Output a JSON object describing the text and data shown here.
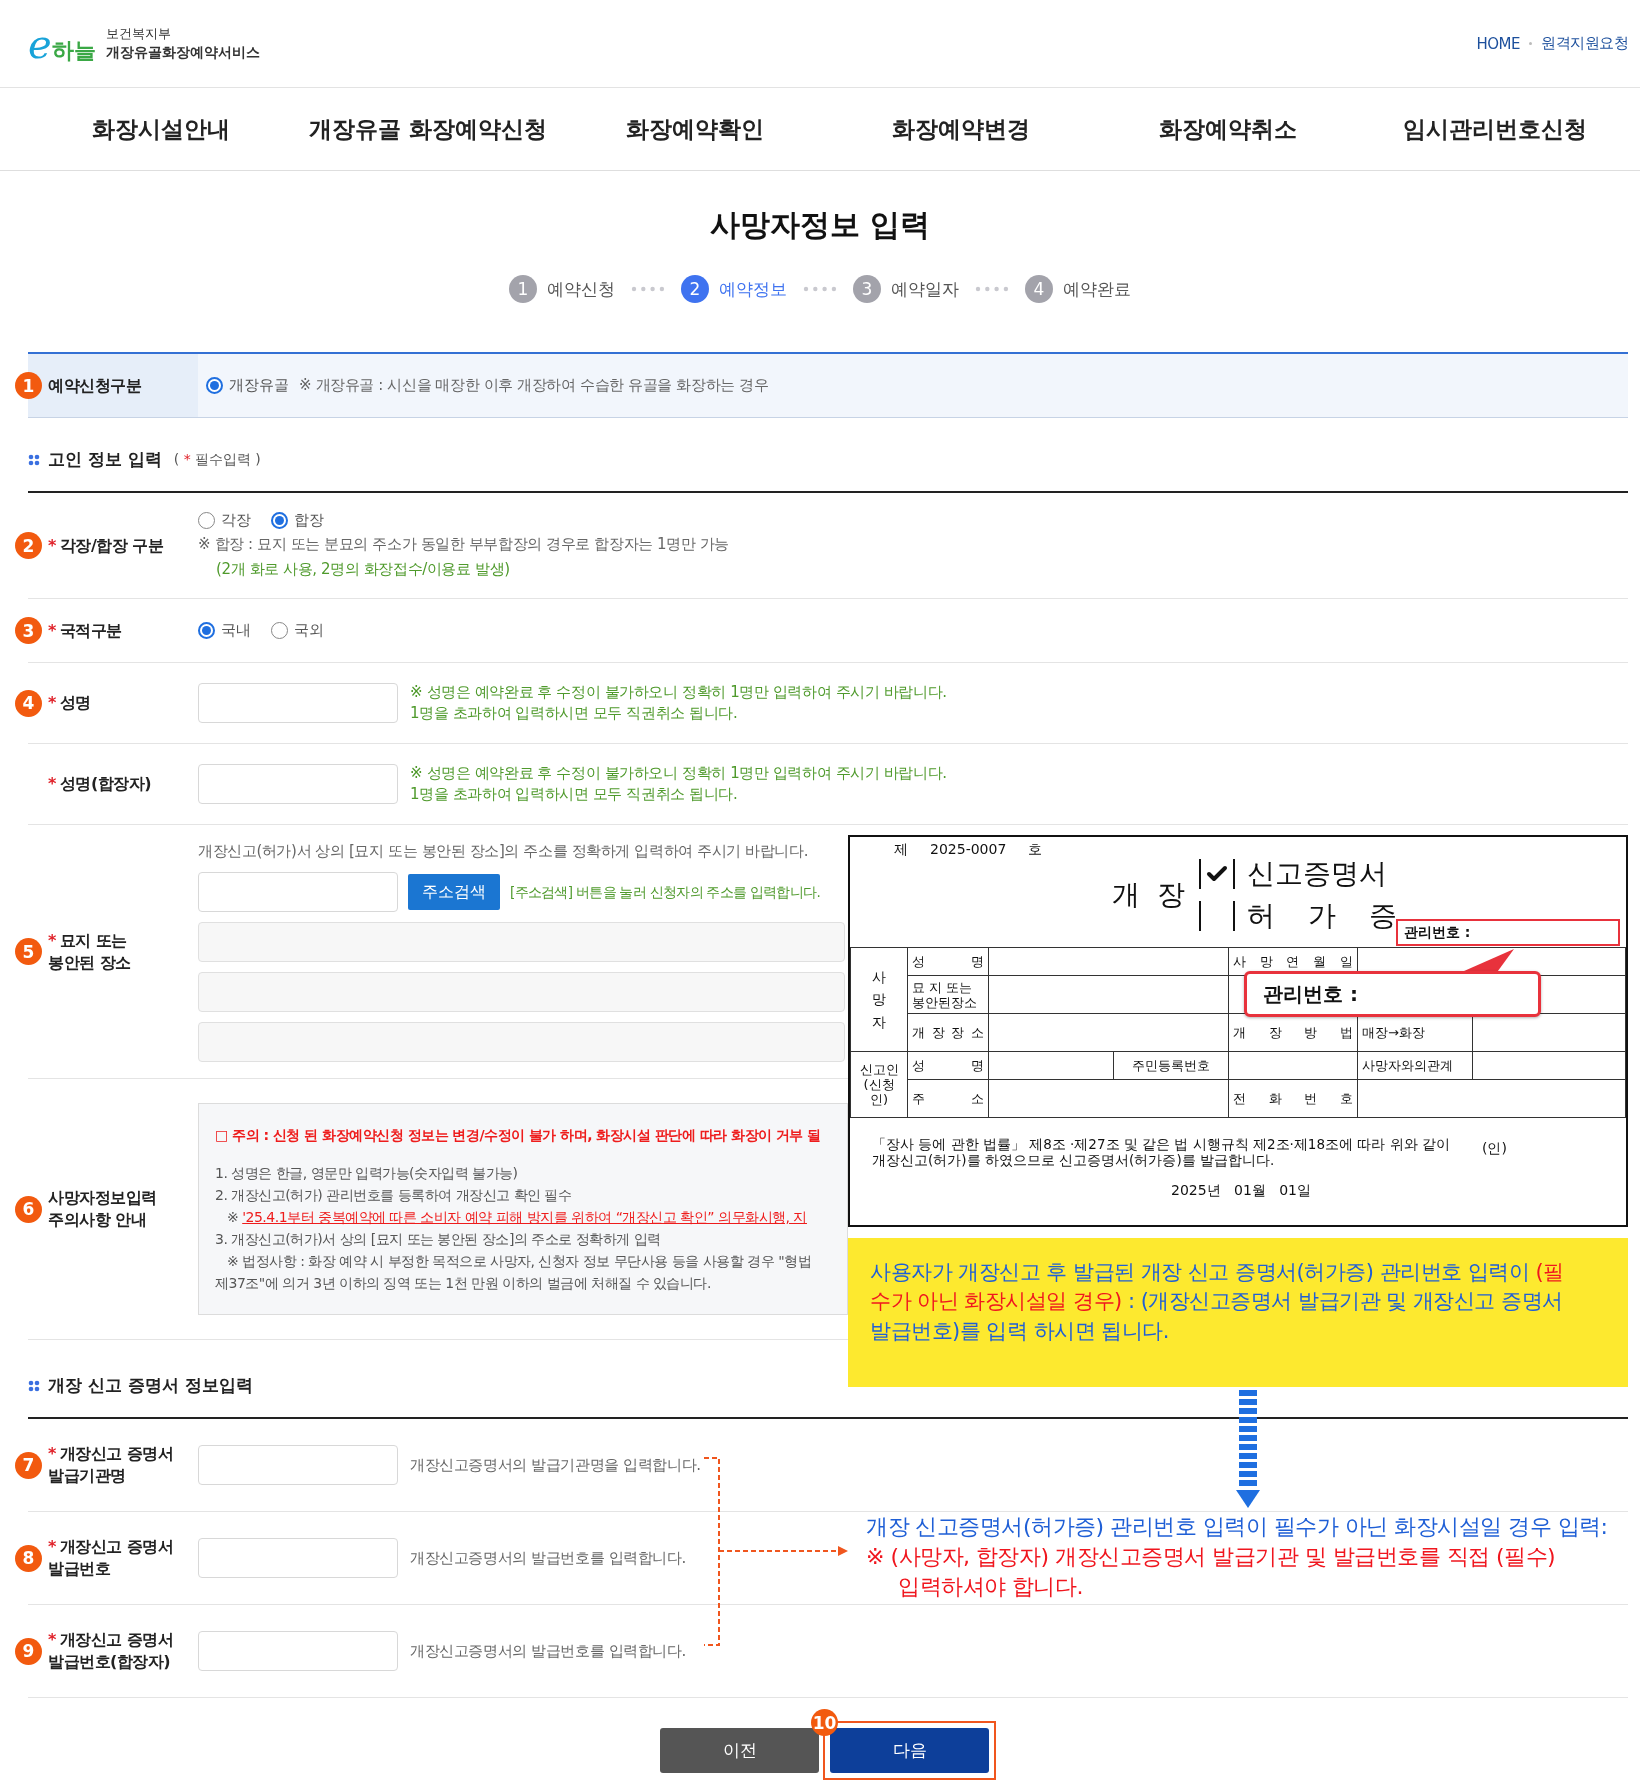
{
  "header": {
    "logo": {
      "mark": "e",
      "word": "하늘"
    },
    "ministry": "보건복지부",
    "service": "개장유골화장예약서비스",
    "links": [
      "HOME",
      "원격지원요청"
    ]
  },
  "nav": [
    "화장시설안내",
    "개장유골 화장예약신청",
    "화장예약확인",
    "화장예약변경",
    "화장예약취소",
    "임시관리번호신청"
  ],
  "page_title": "사망자정보 입력",
  "steps": [
    {
      "number": "1",
      "label": "예약신청",
      "selected": false
    },
    {
      "number": "2",
      "label": "예약정보",
      "selected": true
    },
    {
      "number": "3",
      "label": "예약일자",
      "selected": false
    },
    {
      "number": "4",
      "label": "예약완료",
      "selected": false
    }
  ],
  "reservation_type": {
    "badge": "1",
    "label": "예약신청구분",
    "options": [
      {
        "label": "개장유골",
        "selected": true
      }
    ],
    "note": "※ 개장유골 : 시신을 매장한 이후 개장하여 수습한 유골을 화장하는 경우"
  },
  "deceased_section": {
    "title": "고인 정보 입력",
    "required_hint": {
      "open": "(",
      "mark": "*",
      "text": "필수입력",
      "close": ")"
    },
    "rows": [
      {
        "kind": "radio",
        "badge": "2",
        "required_mark": "*",
        "label_lines": [
          "각장/합장 구분"
        ],
        "options": [
          {
            "label": "각장",
            "selected": false
          },
          {
            "label": "합장",
            "selected": true
          }
        ],
        "note": "※ 합장 : 묘지 또는 분묘의 주소가 동일한 부부합장의 경우로 합장자는 1명만 가능",
        "sub_note": "(2개 화로 사용, 2명의 화장접수/이용료 발생)"
      },
      {
        "kind": "radio",
        "badge": "3",
        "required_mark": "*",
        "label_lines": [
          "국적구분"
        ],
        "options": [
          {
            "label": "국내",
            "selected": true
          },
          {
            "label": "국외",
            "selected": false
          }
        ]
      },
      {
        "kind": "input",
        "badge": "4",
        "required_mark": "*",
        "label_lines": [
          "성명"
        ],
        "hints": [
          "※ 성명은 예약완료 후 수정이 불가하오니 정확히 1명만 입력하여 주시기 바랍니다.",
          "1명을 초과하여 입력하시면 모두 직권취소 됩니다."
        ]
      },
      {
        "kind": "input",
        "required_mark": "*",
        "label_lines": [
          "성명(합장자)"
        ],
        "hints": [
          "※ 성명은 예약완료 후 수정이 불가하오니 정확히 1명만 입력하여 주시기 바랍니다.",
          "1명을 초과하여 입력하시면 모두 직권취소 됩니다."
        ]
      },
      {
        "kind": "address",
        "badge": "5",
        "required_mark": "*",
        "label_lines": [
          "묘지 또는",
          "봉안된 장소"
        ],
        "instruction": "개장신고(허가)서 상의 [묘지 또는 봉안된 장소]의 주소를 정확하게 입력하여 주시기 바랍니다.",
        "search_button": "주소검색",
        "hint": "[주소검색] 버튼을 눌러 신청자의 주소를 입력합니다."
      },
      {
        "kind": "notice",
        "badge": "6",
        "label_lines": [
          "사망자정보입력",
          "주의사항 안내"
        ],
        "lines": [
          {
            "kind": "alert",
            "text": "□ 주의 : 신청 된 화장예약신청 정보는 변경/수정이 불가 하며, 화장시설 판단에 따라 화장이 거부 될"
          },
          {
            "kind": "item",
            "text": "1. 성명은 한글, 영문만 입력가능(숫자입력 불가능)"
          },
          {
            "kind": "item",
            "text": "2. 개장신고(허가) 관리번호를 등록하여 개장신고 확인 필수"
          },
          {
            "kind": "link",
            "mark": "※",
            "text": "'25.4.1부터 중복예약에 따른 소비자 예약 피해 방지를 위하여 “개장신고 확인” 의무화시행, 지"
          },
          {
            "kind": "item",
            "text": "3. 개장신고(허가)서 상의 [묘지 또는 봉안된 장소]의 주소로 정확하게 입력"
          },
          {
            "kind": "sub",
            "text": "※ 법정사항 : 화장 예약 시 부정한 목적으로 사망자, 신청자 정보 무단사용 등을 사용할 경우 \"형법"
          },
          {
            "kind": "item",
            "text": "제37조\"에 의거 3년 이하의 징역 또는 1천 만원 이하의 벌금에 처해질 수 있습니다."
          }
        ]
      }
    ]
  },
  "certificate_section": {
    "title": "개장 신고 증명서 정보입력",
    "rows": [
      {
        "kind": "plain_input",
        "badge": "7",
        "required_mark": "*",
        "label_lines": [
          "개장신고 증명서",
          "발급기관명"
        ],
        "hints": [
          "개장신고증명서의 발급기관명을 입력합니다."
        ]
      },
      {
        "kind": "plain_input",
        "badge": "8",
        "required_mark": "*",
        "label_lines": [
          "개장신고 증명서",
          "발급번호"
        ],
        "hints": [
          "개장신고증명서의 발급번호를 입력합니다."
        ]
      },
      {
        "kind": "plain_input",
        "badge": "9",
        "required_mark": "*",
        "label_lines": [
          "개장신고 증명서",
          "발급번호(합장자)"
        ],
        "hints": [
          "개장신고증명서의 발급번호를 입력합니다."
        ]
      }
    ]
  },
  "buttons": [
    {
      "label": "이전",
      "kind": "secondary",
      "highlighted": false
    },
    {
      "label": "다음",
      "kind": "primary",
      "highlighted": true,
      "badge": "10"
    }
  ],
  "certificate_sample": {
    "number_prefix": "제",
    "number": "2025-0007",
    "number_suffix": "호",
    "title_prefix": "개 장",
    "types": [
      {
        "label": "신고증명서",
        "checked": true
      },
      {
        "label": "허 가 증",
        "checked": false
      }
    ],
    "management_label": "관리번호 :",
    "callout_label": "관리번호 :",
    "deceased_group": "사망자",
    "name_label": "성 명",
    "death_date_label": "사 망 연 월 일",
    "place_label": [
      "묘 지 또는",
      "봉안된장소"
    ],
    "site_label": "개 장 장 소",
    "method_label": "개 장 방 법",
    "method_value": "매장→화장",
    "reporter_group": [
      "신고인",
      "(신청인)"
    ],
    "reporter_name_label": "성 명",
    "id_label": "주민등록번호",
    "relation_label": "사망자와의관계",
    "address_label": "주 소",
    "phone_label": "전 화 번 호",
    "statement": "「장사 등에 관한 법률」 제8조 ·제27조 및 같은 법 시행규칙 제2조·제18조에 따라 위와 같이 개장신고(허가)를 하였으므로 신고증명서(허가증)를 발급합니다.",
    "seal": "(인)",
    "date": "2025년   01월   01일"
  },
  "info_box": {
    "segments": [
      {
        "text": "사용자가 개장신고 후 발급된 개장 신고 증명서(허가증) 관리번호 입력이 ",
        "emphasis": false
      },
      {
        "text": "(필수가 아닌 화장시설일 경우)",
        "emphasis": true
      },
      {
        "text": " : (개장신고증명서 발급기관 및 개장신고 증명서 발급번호)를 입력 하시면 됩니다.",
        "emphasis": false
      }
    ]
  },
  "callout": {
    "lines": [
      {
        "text": "개장 신고증명서(허가증) 관리번호 입력이 필수가 아닌 화장시설일 경우 입력:",
        "emphasis": false
      },
      {
        "text": "※ (사망자, 합장자) 개장신고증명서 발급기관 및 발급번호를 직접 (필수)",
        "emphasis": true
      },
      {
        "text": "입력하셔야 합니다.",
        "emphasis": true
      }
    ]
  }
}
